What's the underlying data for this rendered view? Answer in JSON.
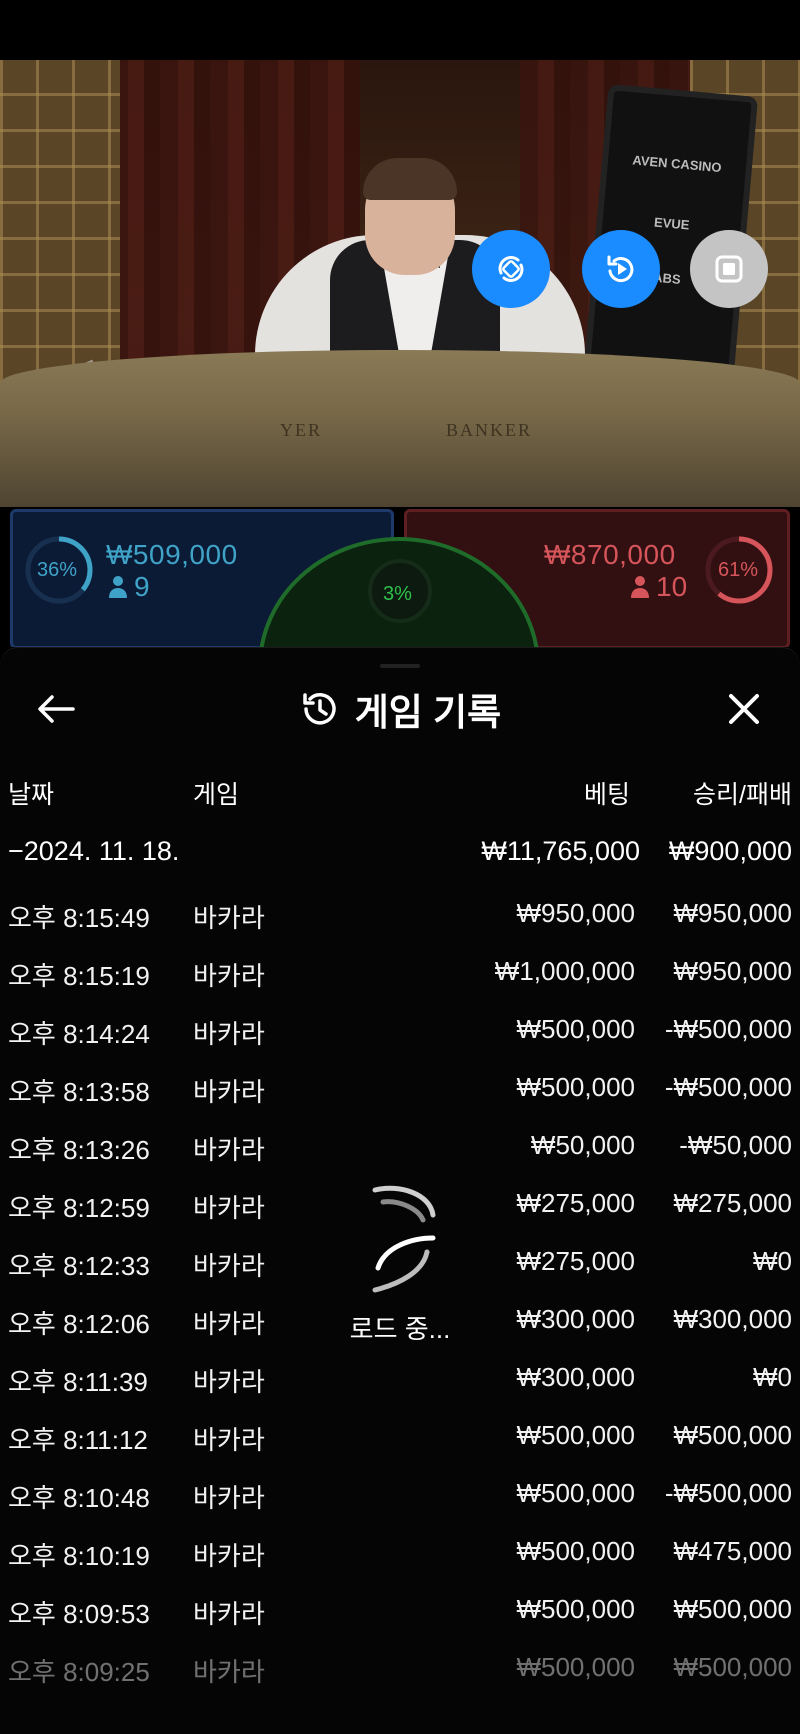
{
  "video": {
    "screen_texts": [
      "AVEN CASINO",
      "EVUE",
      "ABS"
    ],
    "table_labels": [
      "YER",
      "BANKER"
    ],
    "buttons": [
      {
        "name": "rotate-view-icon"
      },
      {
        "name": "replay-video-icon"
      },
      {
        "name": "stop-icon"
      }
    ]
  },
  "betting": {
    "player": {
      "percent": "36%",
      "amount": "₩509,000",
      "players": "9",
      "color": "#3fa3c8"
    },
    "tie": {
      "percent": "3%",
      "color": "#2fc04b"
    },
    "banker": {
      "percent": "61%",
      "amount": "₩870,000",
      "players": "10",
      "color": "#d6555a"
    }
  },
  "history": {
    "title": "게임 기록",
    "columns": {
      "date": "날짜",
      "game": "게임",
      "bet": "베팅",
      "win_loss": "승리/패배"
    },
    "summary": {
      "date": "−2024. 11. 18.",
      "bet": "₩11,765,000",
      "win_loss": "₩900,000"
    },
    "rows": [
      {
        "time": "오후 8:15:49",
        "game": "바카라",
        "bet": "₩950,000",
        "win_loss": "₩950,000"
      },
      {
        "time": "오후 8:15:19",
        "game": "바카라",
        "bet": "₩1,000,000",
        "win_loss": "₩950,000"
      },
      {
        "time": "오후 8:14:24",
        "game": "바카라",
        "bet": "₩500,000",
        "win_loss": "-₩500,000"
      },
      {
        "time": "오후 8:13:58",
        "game": "바카라",
        "bet": "₩500,000",
        "win_loss": "-₩500,000"
      },
      {
        "time": "오후 8:13:26",
        "game": "바카라",
        "bet": "₩50,000",
        "win_loss": "-₩50,000"
      },
      {
        "time": "오후 8:12:59",
        "game": "바카라",
        "bet": "₩275,000",
        "win_loss": "₩275,000"
      },
      {
        "time": "오후 8:12:33",
        "game": "바카라",
        "bet": "₩275,000",
        "win_loss": "₩0"
      },
      {
        "time": "오후 8:12:06",
        "game": "바카라",
        "bet": "₩300,000",
        "win_loss": "₩300,000"
      },
      {
        "time": "오후 8:11:39",
        "game": "바카라",
        "bet": "₩300,000",
        "win_loss": "₩0"
      },
      {
        "time": "오후 8:11:12",
        "game": "바카라",
        "bet": "₩500,000",
        "win_loss": "₩500,000"
      },
      {
        "time": "오후 8:10:48",
        "game": "바카라",
        "bet": "₩500,000",
        "win_loss": "-₩500,000"
      },
      {
        "time": "오후 8:10:19",
        "game": "바카라",
        "bet": "₩500,000",
        "win_loss": "₩475,000"
      },
      {
        "time": "오후 8:09:53",
        "game": "바카라",
        "bet": "₩500,000",
        "win_loss": "₩500,000"
      },
      {
        "time": "오후 8:09:25",
        "game": "바카라",
        "bet": "₩500,000",
        "win_loss": "₩500,000"
      }
    ],
    "loading_label": "로드 중..."
  }
}
